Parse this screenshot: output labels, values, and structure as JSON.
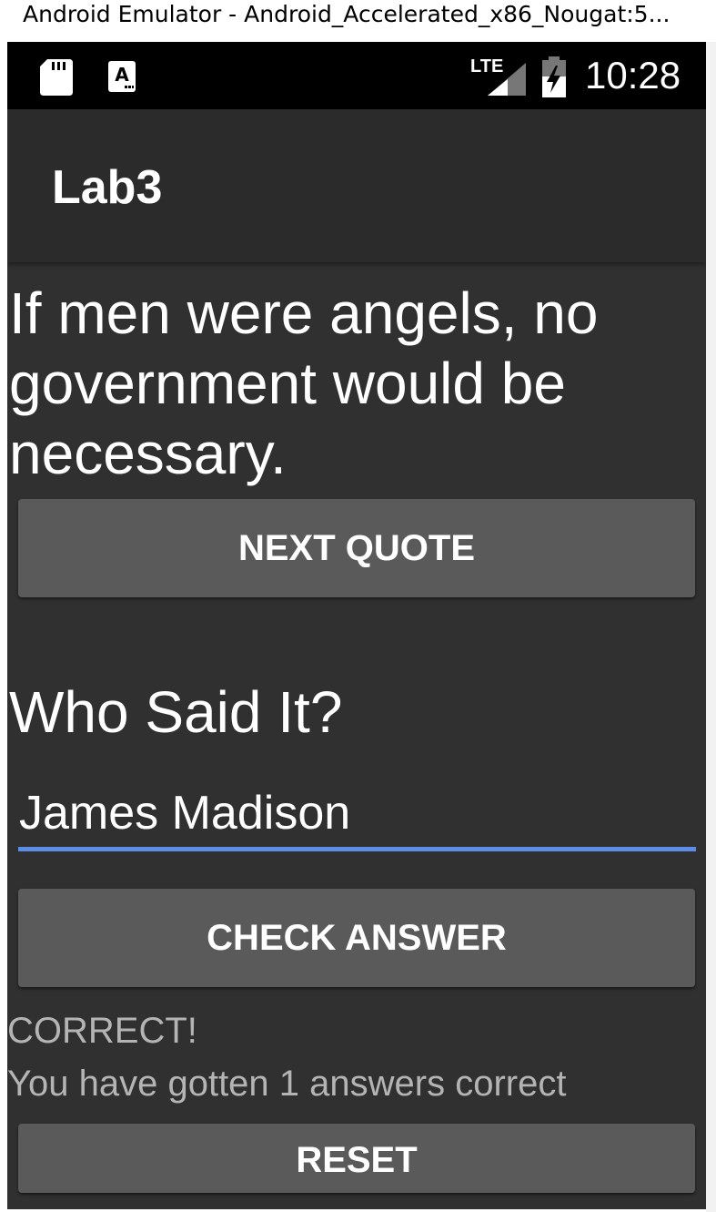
{
  "window": {
    "title": "Android Emulator - Android_Accelerated_x86_Nougat:5..."
  },
  "statusbar": {
    "network_label": "LTE",
    "time": "10:28",
    "icons": [
      "sd-card-icon",
      "accessibility-a-icon",
      "lte-signal-icon",
      "battery-charging-icon"
    ]
  },
  "app": {
    "title": "Lab3",
    "quote": "If men were angels, no government would be necessary.",
    "next_button": "NEXT QUOTE",
    "question_heading": "Who Said It?",
    "answer_input": {
      "value": "James Madison",
      "placeholder": ""
    },
    "check_button": "CHECK ANSWER",
    "result_text": "CORRECT!",
    "score_text": "You have gotten 1 answers correct",
    "reset_button": "RESET"
  },
  "colors": {
    "background": "#303030",
    "appbar": "#2b2b2b",
    "button": "#5a5a5b",
    "accent_underline": "#5b8de6",
    "secondary_text": "#b4b4b4"
  }
}
